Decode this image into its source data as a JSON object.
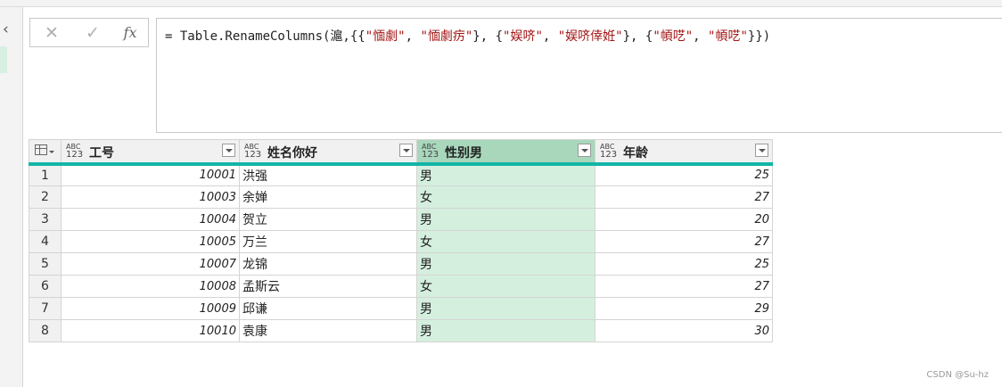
{
  "formula": {
    "prefix": "= Table.RenameColumns(滬,{{",
    "s1": "\"愐劇\"",
    "sep1": ", ",
    "s2": "\"愐劇疠\"",
    "sep2": "}, {",
    "s3": "\"娱哜\"",
    "sep3": ", ",
    "s4": "\"娱哜倖姙\"",
    "sep4": "}, {",
    "s5": "\"幁呓\"",
    "sep5": ", ",
    "s6": "\"幁呓\"",
    "suffix": "}})"
  },
  "fx_buttons": {
    "cancel": "✕",
    "commit": "✓",
    "func": "fx"
  },
  "left_panel": {
    "collapse_glyph": "‹"
  },
  "type_icon": {
    "line1": "ABC",
    "line2": "123"
  },
  "columns": [
    "工号",
    "姓名你好",
    "性别男",
    "年龄"
  ],
  "selected_column": 2,
  "rows": [
    {
      "n": "1",
      "id": "10001",
      "name": "洪强",
      "gender": "男",
      "age": "25"
    },
    {
      "n": "2",
      "id": "10003",
      "name": "余婵",
      "gender": "女",
      "age": "27"
    },
    {
      "n": "3",
      "id": "10004",
      "name": "贺立",
      "gender": "男",
      "age": "20"
    },
    {
      "n": "4",
      "id": "10005",
      "name": "万兰",
      "gender": "女",
      "age": "27"
    },
    {
      "n": "5",
      "id": "10007",
      "name": "龙锦",
      "gender": "男",
      "age": "25"
    },
    {
      "n": "6",
      "id": "10008",
      "name": "孟斯云",
      "gender": "女",
      "age": "27"
    },
    {
      "n": "7",
      "id": "10009",
      "name": "邱谦",
      "gender": "男",
      "age": "29"
    },
    {
      "n": "8",
      "id": "10010",
      "name": "袁康",
      "gender": "男",
      "age": "30"
    }
  ],
  "watermark": "CSDN @Su-hz"
}
